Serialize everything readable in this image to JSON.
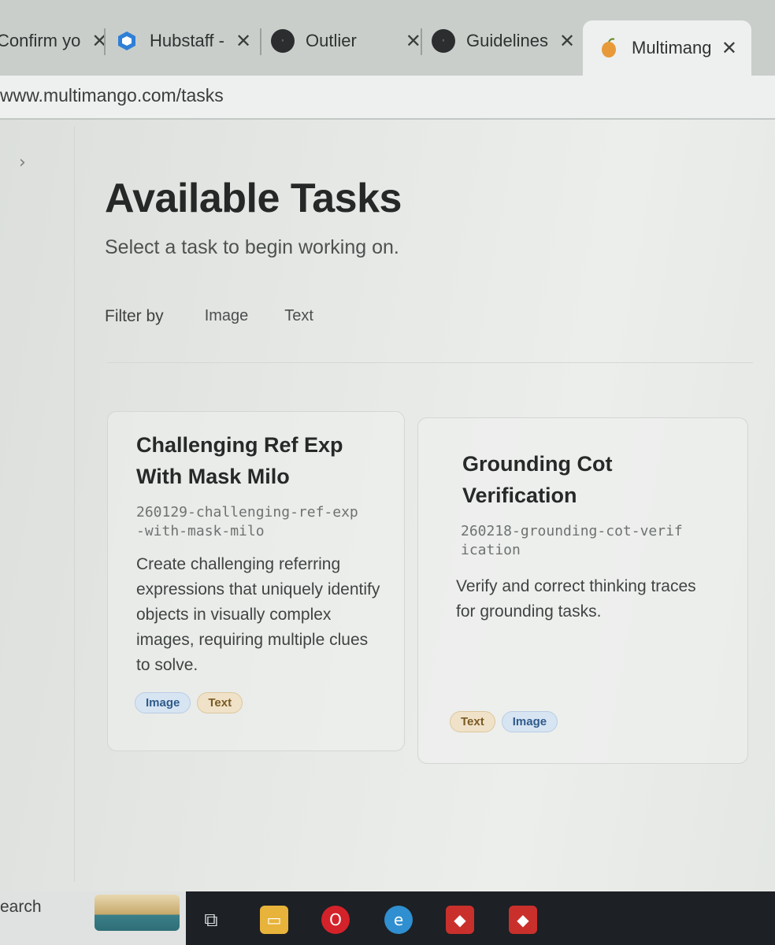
{
  "browser": {
    "tabs": [
      {
        "title": "Confirm yo",
        "favicon": "none",
        "active": false
      },
      {
        "title": "Hubstaff -",
        "favicon": "hubstaff-icon",
        "active": false
      },
      {
        "title": "Outlier",
        "favicon": "outlier-icon",
        "active": false
      },
      {
        "title": "Guidelines",
        "favicon": "outlier-icon",
        "active": false
      },
      {
        "title": "Multimang",
        "favicon": "mango-icon",
        "active": true
      }
    ],
    "close_glyph": "✕",
    "url": "www.multimango.com/tasks"
  },
  "sidebar": {
    "toggle_glyph": "›"
  },
  "page": {
    "title": "Available Tasks",
    "subtitle": "Select a task to begin working on.",
    "filter": {
      "label": "Filter by",
      "options": [
        "Image",
        "Text"
      ]
    }
  },
  "tasks": [
    {
      "title": "Challenging Ref Exp With Mask Milo",
      "id": "260129-challenging-ref-exp-with-mask-milo",
      "description": "Create challenging referring expressions that uniquely identify objects in visually complex images, requiring multiple clues to solve.",
      "tags": [
        "Image",
        "Text"
      ]
    },
    {
      "title": "Grounding Cot Verification",
      "id": "260218-grounding-cot-verification",
      "description": "Verify and correct thinking traces for grounding tasks.",
      "tags": [
        "Text",
        "Image"
      ]
    }
  ],
  "taskbar": {
    "search_text": "earch",
    "icons": [
      "task-view-icon",
      "file-explorer-icon",
      "opera-icon",
      "edge-icon",
      "app-icon",
      "app-icon"
    ]
  },
  "colors": {
    "tag_image_bg": "#d7e4f2",
    "tag_text_bg": "#f0e2c8"
  }
}
